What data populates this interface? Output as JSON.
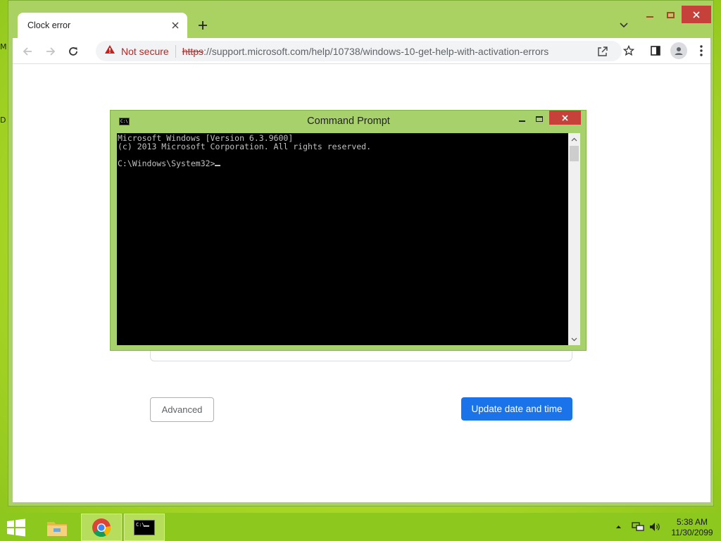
{
  "desktop": {
    "labels": [
      "M",
      "D"
    ]
  },
  "browser": {
    "tab_title": "Clock error",
    "address": {
      "not_secure": "Not secure",
      "scheme": "https",
      "rest": "://support.microsoft.com/help/10738/windows-10-get-help-with-activation-errors"
    },
    "buttons": {
      "advanced": "Advanced",
      "update": "Update date and time"
    }
  },
  "cmd": {
    "title": "Command Prompt",
    "lines": [
      "Microsoft Windows [Version 6.3.9600]",
      "(c) 2013 Microsoft Corporation. All rights reserved.",
      "",
      "C:\\Windows\\System32>"
    ]
  },
  "taskbar": {
    "time": "5:38 AM",
    "date": "11/30/2099"
  },
  "colors": {
    "accent": "#1a73e8",
    "not_secure": "#c5221f",
    "window_frame": "#a7d16a",
    "close": "#c7413b"
  }
}
